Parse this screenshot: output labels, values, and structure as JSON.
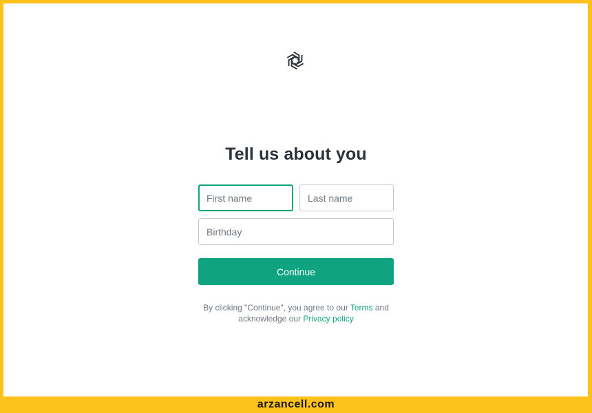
{
  "brand": {
    "logo_icon": "openai-logo-icon",
    "accent_color": "#10a37f",
    "frame_color": "#fcc21b"
  },
  "page": {
    "title": "Tell us about you"
  },
  "form": {
    "first_name": {
      "placeholder": "First name",
      "value": ""
    },
    "last_name": {
      "placeholder": "Last name",
      "value": ""
    },
    "birthday": {
      "placeholder": "Birthday",
      "value": ""
    },
    "continue_label": "Continue"
  },
  "legal": {
    "prefix": "By clicking \"Continue\", you agree to our ",
    "terms_label": "Terms",
    "middle": " and acknowledge our ",
    "privacy_label": "Privacy policy"
  },
  "watermark": {
    "text": "arzancell.com"
  }
}
